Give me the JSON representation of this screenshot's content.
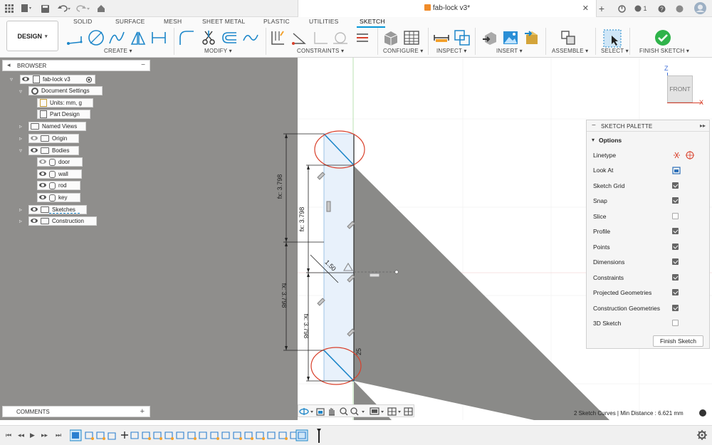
{
  "window": {
    "doc_title": "fab-lock v3*",
    "notification_count": "1"
  },
  "ribbon": {
    "design_label": "DESIGN",
    "tabs": [
      "SOLID",
      "SURFACE",
      "MESH",
      "SHEET METAL",
      "PLASTIC",
      "UTILITIES",
      "SKETCH"
    ],
    "active_tab": "SKETCH",
    "groups": [
      "CREATE ▾",
      "MODIFY ▾",
      "CONSTRAINTS ▾",
      "CONFIGURE ▾",
      "INSPECT ▾",
      "INSERT ▾",
      "ASSEMBLE ▾",
      "SELECT ▾",
      "FINISH SKETCH ▾"
    ]
  },
  "browser": {
    "title": "BROWSER",
    "root": "fab-lock v3",
    "items": [
      {
        "label": "Document Settings"
      },
      {
        "label": "Units: mm, g"
      },
      {
        "label": "Part Design"
      },
      {
        "label": "Named Views"
      },
      {
        "label": "Origin"
      },
      {
        "label": "Bodies"
      },
      {
        "label": "door"
      },
      {
        "label": "wall"
      },
      {
        "label": "rod"
      },
      {
        "label": "key"
      },
      {
        "label": "Sketches"
      },
      {
        "label": "Construction"
      }
    ]
  },
  "comments": {
    "title": "COMMENTS"
  },
  "viewcube": {
    "face": "FRONT",
    "axis_z": "Z",
    "axis_x": "X"
  },
  "sketch": {
    "dims": [
      "fx: 3.798",
      "fx: 3.798",
      "fx: 3.798",
      "fx: 3.798",
      "1.50",
      "25"
    ]
  },
  "palette": {
    "title": "SKETCH PALETTE",
    "section": "Options",
    "rows": [
      {
        "label": "Linetype",
        "kind": "icons"
      },
      {
        "label": "Look At",
        "kind": "icon"
      },
      {
        "label": "Sketch Grid",
        "checked": true
      },
      {
        "label": "Snap",
        "checked": true
      },
      {
        "label": "Slice",
        "checked": false
      },
      {
        "label": "Profile",
        "checked": true
      },
      {
        "label": "Points",
        "checked": true
      },
      {
        "label": "Dimensions",
        "checked": true
      },
      {
        "label": "Constraints",
        "checked": true
      },
      {
        "label": "Projected Geometries",
        "checked": true
      },
      {
        "label": "Construction Geometries",
        "checked": true
      },
      {
        "label": "3D Sketch",
        "checked": false
      }
    ],
    "finish_button": "Finish Sketch"
  },
  "status": {
    "text": "2 Sketch Curves | Min Distance : 6.621 mm"
  },
  "colors": {
    "accent": "#0696d7",
    "highlight_circle": "#d9402b",
    "confirm": "#2fb34a"
  }
}
